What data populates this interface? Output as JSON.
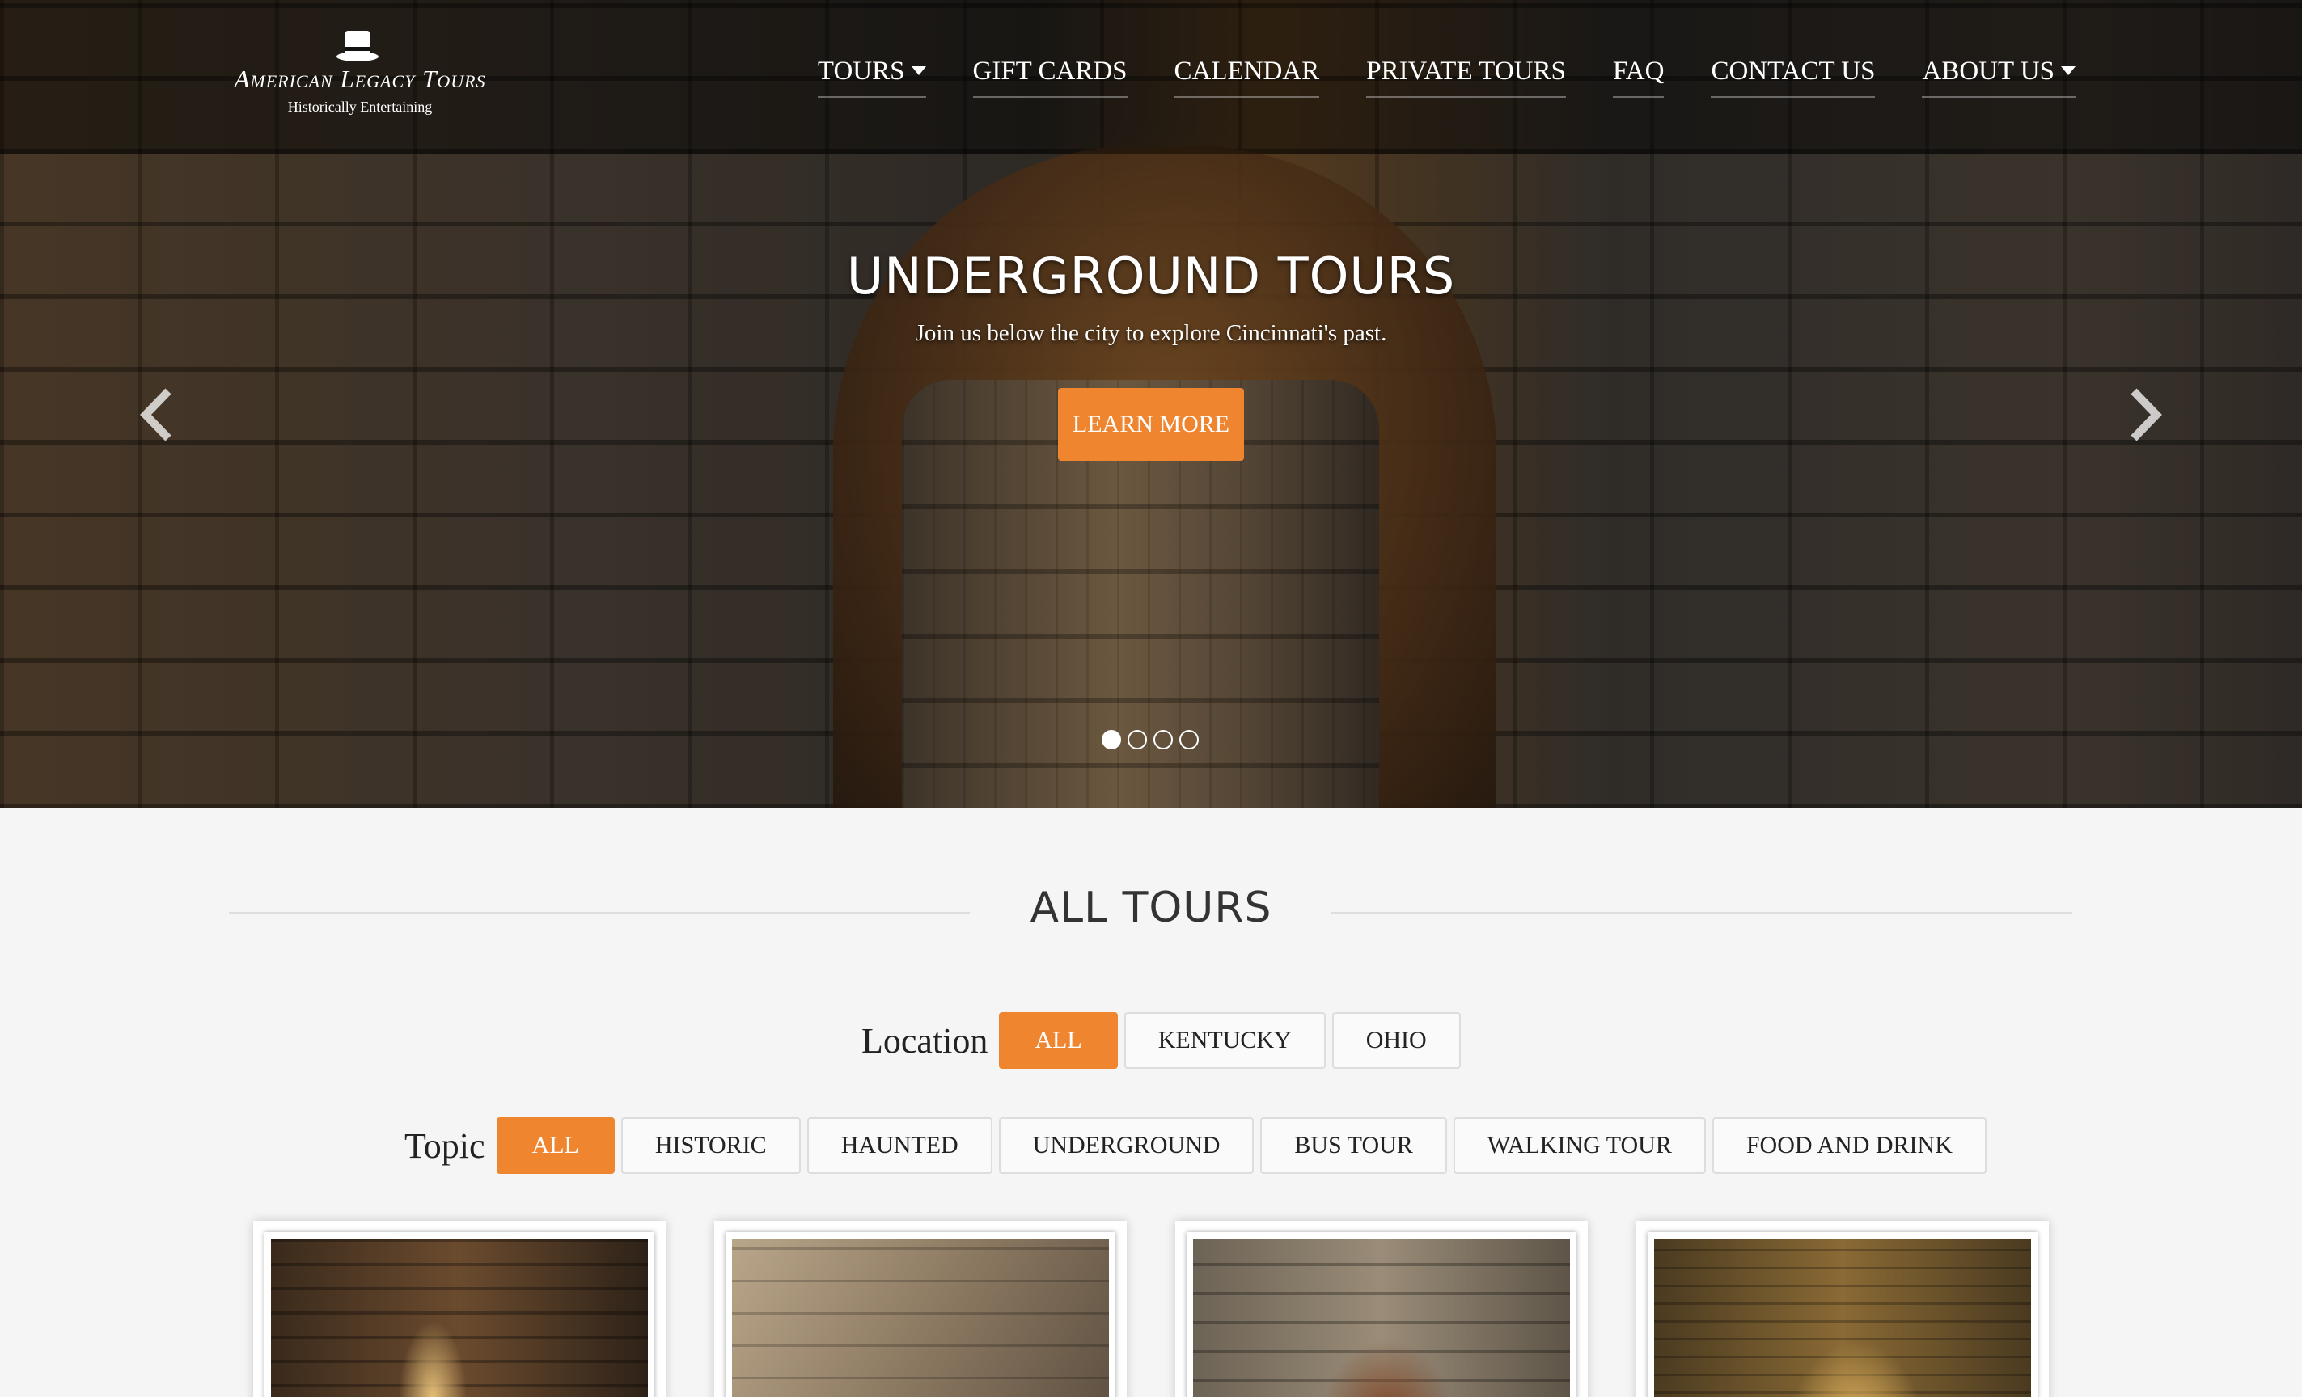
{
  "site": {
    "logo_name": "American Legacy Tours",
    "logo_tagline": "Historically Entertaining",
    "logo_icon": "top-hat-icon"
  },
  "nav": {
    "items": [
      {
        "label": "TOURS",
        "has_dropdown": true
      },
      {
        "label": "GIFT CARDS",
        "has_dropdown": false
      },
      {
        "label": "CALENDAR",
        "has_dropdown": false
      },
      {
        "label": "PRIVATE TOURS",
        "has_dropdown": false
      },
      {
        "label": "FAQ",
        "has_dropdown": false
      },
      {
        "label": "CONTACT US",
        "has_dropdown": false
      },
      {
        "label": "ABOUT US",
        "has_dropdown": true
      }
    ]
  },
  "hero": {
    "title": "UNDERGROUND TOURS",
    "subtitle": "Join us below the city to explore Cincinnati's past.",
    "button_label": "LEARN MORE",
    "slide_count": 4,
    "active_slide": 1,
    "prev_icon": "chevron-left-icon",
    "next_icon": "chevron-right-icon"
  },
  "section": {
    "title": "ALL TOURS"
  },
  "filters": {
    "location_label": "Location",
    "location_options": [
      "ALL",
      "KENTUCKY",
      "OHIO"
    ],
    "location_selected": "ALL",
    "topic_label": "Topic",
    "topic_options": [
      "ALL",
      "HISTORIC",
      "HAUNTED",
      "UNDERGROUND",
      "BUS TOUR",
      "WALKING TOUR",
      "FOOD AND DRINK"
    ],
    "topic_selected": "ALL"
  },
  "colors": {
    "accent": "#f0852f",
    "background": "#f5f5f5",
    "nav_text": "#ffffff"
  }
}
